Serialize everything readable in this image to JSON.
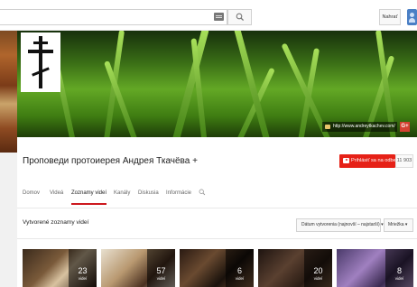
{
  "topbar": {
    "upload_label": "Nahrať"
  },
  "banner": {
    "link_text": "http://www.andreytkachev.com/",
    "gplus_label": "G+"
  },
  "channel": {
    "title": "Проповеди протоиерея Андрея Ткачёва +",
    "subscribe_label": "Prihlásiť sa na odber",
    "subscriber_count": "11 903"
  },
  "tabs": [
    {
      "label": "Domov",
      "active": false
    },
    {
      "label": "Videá",
      "active": false
    },
    {
      "label": "Zoznamy videí",
      "active": true
    },
    {
      "label": "Kanály",
      "active": false
    },
    {
      "label": "Diskusia",
      "active": false
    },
    {
      "label": "Informácie",
      "active": false
    }
  ],
  "section": {
    "title": "Vytvorené zoznamy videí",
    "sort_label": "Dátum vytvorenia (najnovší – najstarší) ▾",
    "view_label": "Mriežka ▾"
  },
  "playlists": [
    {
      "count": "23",
      "label": "videí"
    },
    {
      "count": "57",
      "label": "videí"
    },
    {
      "count": "6",
      "label": "videí"
    },
    {
      "count": "20",
      "label": "videí"
    },
    {
      "count": "8",
      "label": "videí"
    }
  ],
  "colors": {
    "accent_red": "#e62117",
    "tab_underline": "#cc181e"
  },
  "icons": {
    "search": "search-icon",
    "keyboard": "keyboard-icon",
    "cross": "orthodox-cross-icon"
  }
}
